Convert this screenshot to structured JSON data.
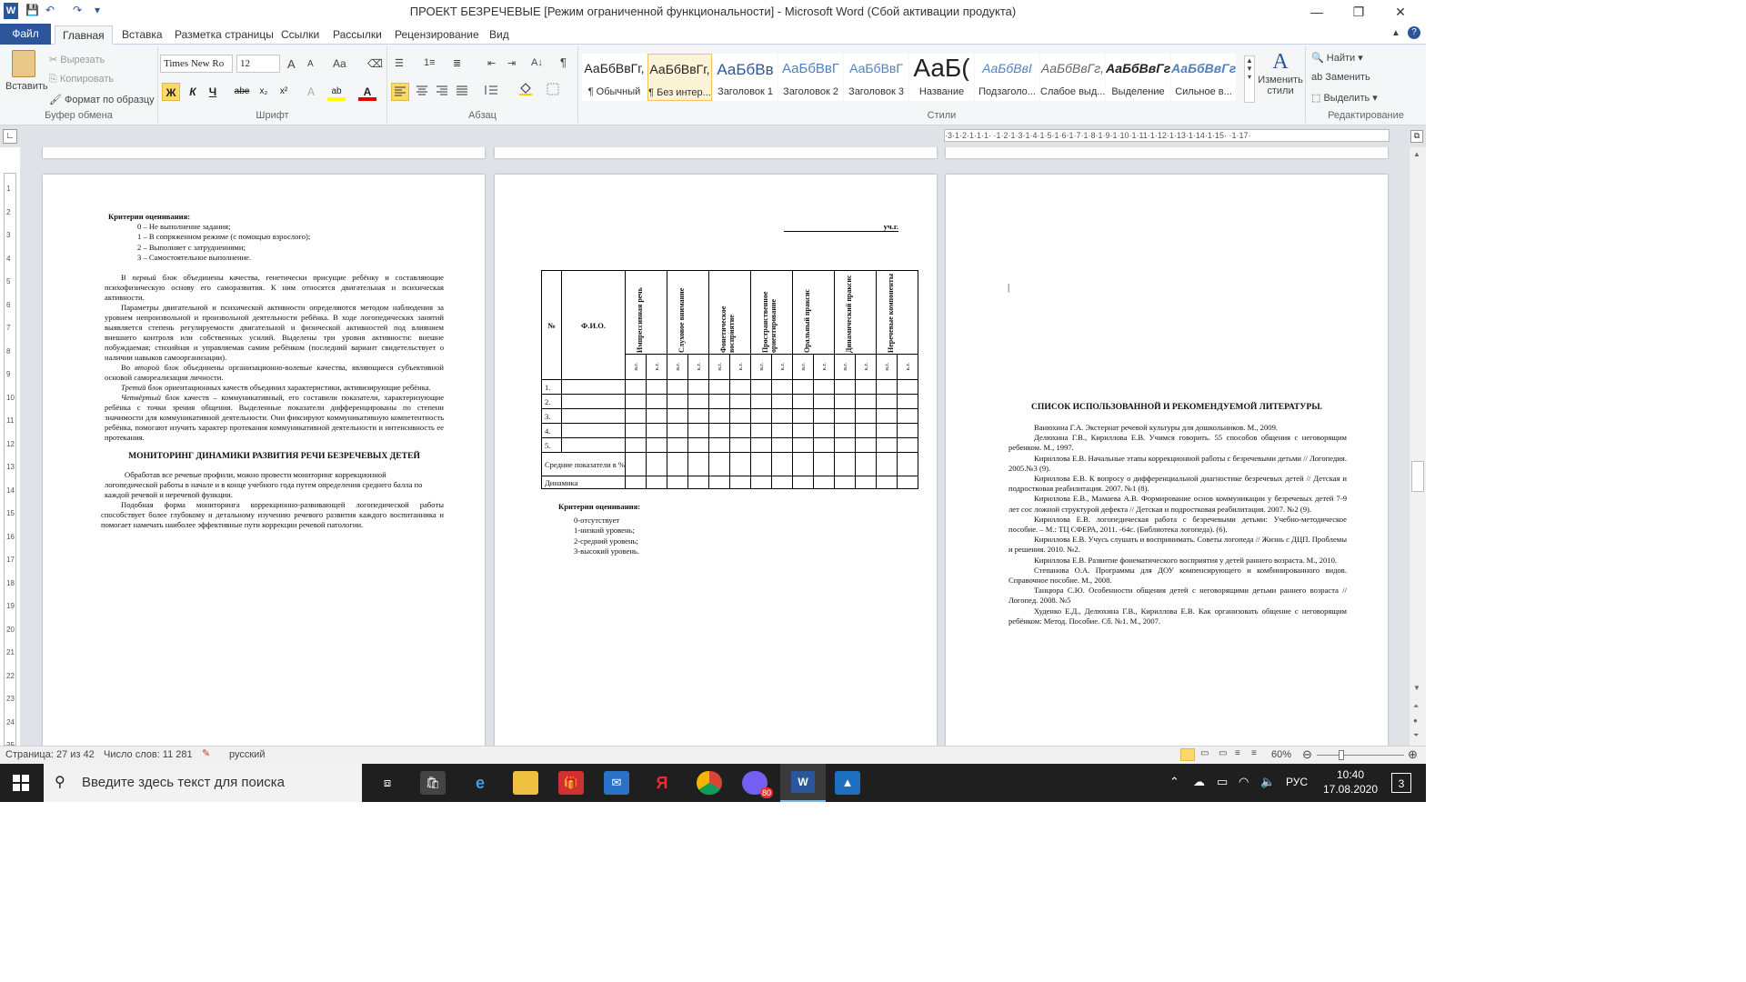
{
  "window": {
    "title": "ПРОЕКТ БЕЗРЕЧЕВЫЕ [Режим ограниченной функциональности]  -  Microsoft Word (Сбой активации продукта)",
    "app_icon": "W",
    "minimize": "—",
    "maximize": "❐",
    "close": "✕"
  },
  "quick_access": {
    "save": "💾",
    "undo": "↶",
    "redo": "↷",
    "customize": "▾"
  },
  "tabs": [
    "Файл",
    "Главная",
    "Вставка",
    "Разметка страницы",
    "Ссылки",
    "Рассылки",
    "Рецензирование",
    "Вид"
  ],
  "active_tab": "Главная",
  "ribbon": {
    "clipboard": {
      "paste": "Вставить",
      "cut": "Вырезать",
      "copy": "Копировать",
      "format_painter": "Формат по образцу",
      "group_label": "Буфер обмена"
    },
    "font": {
      "family": "Times New Ro",
      "size": "12",
      "group_label": "Шрифт",
      "grow": "A",
      "shrink": "A",
      "case": "Aa",
      "clear": "⌫",
      "bold": "Ж",
      "italic": "К",
      "underline": "Ч",
      "strike": "abe",
      "subscript": "x₂",
      "superscript": "x²",
      "effects": "A",
      "highlight": "ab",
      "color": "A"
    },
    "paragraph": {
      "group_label": "Абзац",
      "bullets": "☰",
      "numbering": "1≡",
      "multilevel": "≣",
      "decrease": "⇤",
      "increase": "⇥",
      "sort": "A↓",
      "marks": "¶"
    },
    "styles": {
      "group_label": "Стили",
      "items": [
        {
          "preview": "АаБбВвГг,",
          "name": "¶ Обычный"
        },
        {
          "preview": "АаБбВвГг,",
          "name": "¶ Без интер..."
        },
        {
          "preview": "АаБбВв",
          "name": "Заголовок 1"
        },
        {
          "preview": "АаБбВвГ",
          "name": "Заголовок 2"
        },
        {
          "preview": "АаБбВвГ",
          "name": "Заголовок 3"
        },
        {
          "preview": "АаБ(",
          "name": "Название"
        },
        {
          "preview": "АаБбВвІ",
          "name": "Подзаголо..."
        },
        {
          "preview": "АаБбВвГг,",
          "name": "Слабое выд..."
        },
        {
          "preview": "АаБбВвГг,",
          "name": "Выделение"
        },
        {
          "preview": "АаБбВвГг",
          "name": "Сильное в..."
        }
      ],
      "change_styles": "Изменить стили"
    },
    "editing": {
      "find": "Найти",
      "replace": "Заменить",
      "select": "Выделить",
      "group_label": "Редактирование"
    }
  },
  "ruler_ticks": "·3·1·2·1·1·1· ·1·2·1·3·1·4·1·5·1·6·1·7·1·8·1·9·1·10·1·11·1·12·1·13·1·14·1·15· ·1·17·",
  "vruler_ticks": [
    "1",
    "2",
    "3",
    "4",
    "5",
    "6",
    "7",
    "8",
    "9",
    "10",
    "11",
    "12",
    "13",
    "14",
    "15",
    "16",
    "17",
    "18",
    "19",
    "20",
    "21",
    "22",
    "23",
    "24",
    "25"
  ],
  "page1": {
    "criteria_title": "Критерии оценивания:",
    "criteria": [
      "0 – Не выполнение задания;",
      "1 – В сопряженном режиме (с помощью взрослого);",
      "2 – Выполняет с затруднениями;",
      "3 – Самостоятельное выполнение."
    ],
    "para1_pre": "В ",
    "para1_em": "первый блок",
    "para1_post": " объединены качества, генетически присущие ребёнку и составляющие психофизическую основу его саморазвития.  К ним относятся двигательная и психическая активности.",
    "para2": "Параметры двигательной и психической активности определяются методом наблюдения за уровнем непроизвольной и произвольной деятельности ребёнка. В ходе логопедических занятий выявляется степень регулируемости двигательной и физической активностей под влиянием внешнего контроля или собственных усилий. Выделены три уровня активности: внешне побуждаемая; стихийная и управляемая самим ребёнком (последний вариант свидетельствует о наличии навыков самоорганизации).",
    "para3_pre": "Во ",
    "para3_em": "второй блок",
    "para3_post": " объединены организационно-волевые качества, являющиеся субъективной основой самореализации личности.",
    "para4_em": "Третий блок",
    "para4_post": " ориентационных качеств объединил характеристики, активизирующие ребёнка.",
    "para5_em": "Четвёртый блок",
    "para5_post": " качеств – коммуникативный, его составили показатели, характеризующие ребёнка с точки зрения общения. Выделенные показатели дифференцированы по степени значимости для коммуникативной деятельности. Они фиксируют коммуникативную компетентность ребёнка, помогают изучить характер протекания коммуникативной деятельности и интенсивность ее протекания.",
    "heading": "МОНИТОРИНГ ДИНАМИКИ РАЗВИТИЯ РЕЧИ БЕЗРЕЧЕВЫХ ДЕТЕЙ",
    "para6": "Обработав все речевые профили, можно провести мониторинг коррекционной логопедической работы в начале и в конце учебного года путем определения среднего балла по каждой речевой и неречевой функции.",
    "para7": "Подобная форма мониторинга коррекционно-развивающей логопедической работы способствует более глубокому и детальному изучению речевого развития каждого воспитанника и помогает намечать наиболее эффективные пути коррекции речевой патологии."
  },
  "page2": {
    "year_suffix": "уч.г.",
    "col_num": "№",
    "col_name": "Ф.И.О.",
    "columns": [
      "Импрессивная речь",
      "Слуховое внимание",
      "Фонетическое восприятие",
      "Пространственное ориентирование",
      "Оральный праксис",
      "Динамический праксис",
      "Неречевые компоненты"
    ],
    "sub_start": "н.г.",
    "sub_end": "к.г.",
    "rows": [
      "1.",
      "2.",
      "3.",
      "4.",
      "5."
    ],
    "avg_row": "Средние показатели в %",
    "dyn_row": "Динамика",
    "criteria_title": "Критерии оценивания:",
    "criteria": [
      "0-отсутствует",
      "1-низкий уровень;",
      "2-средний уровень;",
      "3-высокий уровень."
    ]
  },
  "page3": {
    "cursor": "|",
    "heading": "СПИСОК ИСПОЛЬЗОВАННОЙ И РЕКОМЕНДУЕМОЙ ЛИТЕРАТУРЫ.",
    "refs": [
      "Ванюхина Г.А. Экстернат речевой культуры для дошкольников. М., 2009.",
      "Делюхина Г.В., Кириллова Е.В. Учимся говорить. 55 способов общения с неговорящим ребенком. М., 1997.",
      "Кириллова Е.В. Начальные этапы коррекционной работы с безречевыми детьми // Логопедия. 2005.№3 (9).",
      "Кириллова Е.В. К вопросу о дифференциальной диагностике безречевых детей // Детская и подростковая реабилитация. 2007. №1 (8).",
      "Кириллова Е.В., Мамаева А.В. Формирование основ коммуникации у безречевых детей 7-9 лет сос ложной структурой дефекта // Детская и подростковая реабилитация. 2007. №2 (9).",
      "Кириллова Е.В.  логопедическая работа с безречевыми детьми: Учебно-методическое пособие. – М.: ТЦ СФЕРА, 2011. -64с. (Библиотека логопеда). (6).",
      "Кириллова Е.В. Учусь слушать и воспринимать. Советы логопеда // Жизнь с ДЦП. Проблемы и решения. 2010. №2.",
      "Кириллова Е.В. Развитие фонематического восприятия у детей раннего возраста. М., 2010.",
      "Степанова О.А. Программы для ДОУ компенсирующего и комбинированного видов. Справочное пособие. М., 2008.",
      "Танцюра С.Ю.  Особенности общения детей с неговорящими детьми раннего возраста // Логопед. 2008. №5",
      "Худенко Е.Д., Делюхина Г.В., Кириллова Е.В. Как организовать общение с неговорящим ребёнком: Метод. Пособие. Сб. №1. М., 2007."
    ]
  },
  "status": {
    "page": "Страница: 27 из 42",
    "words": "Число слов: 11 281",
    "lang": "русский",
    "zoom": "60%"
  },
  "taskbar": {
    "search_placeholder": "Введите здесь текст для поиска",
    "lang": "РУС",
    "time": "10:40",
    "date": "17.08.2020",
    "notif_count": "3",
    "viber_badge": "80"
  }
}
